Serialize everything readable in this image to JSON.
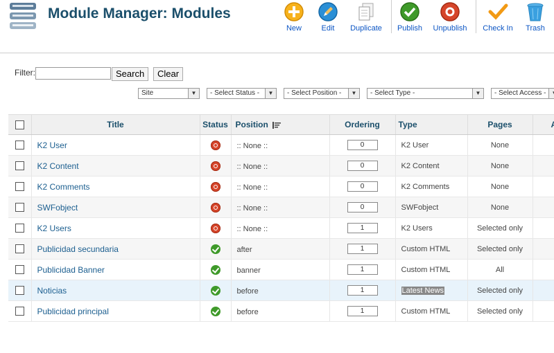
{
  "header": {
    "title": "Module Manager: Modules",
    "toolbar": [
      {
        "label": "New",
        "icon": "new-icon"
      },
      {
        "label": "Edit",
        "icon": "edit-icon"
      },
      {
        "label": "Duplicate",
        "icon": "duplicate-icon"
      },
      {
        "label": "Publish",
        "icon": "publish-icon"
      },
      {
        "label": "Unpublish",
        "icon": "unpublish-icon"
      },
      {
        "label": "Check In",
        "icon": "check-in-icon"
      },
      {
        "label": "Trash",
        "icon": "trash-icon"
      }
    ]
  },
  "filter": {
    "label": "Filter:",
    "value": "",
    "search_label": "Search",
    "clear_label": "Clear"
  },
  "selects": {
    "client": "Site",
    "status": "- Select Status -",
    "position": "- Select Position -",
    "type": "- Select Type -",
    "access": "- Select Access -"
  },
  "table": {
    "headers": {
      "title": "Title",
      "status": "Status",
      "position": "Position",
      "ordering": "Ordering",
      "type": "Type",
      "pages": "Pages",
      "access": "A"
    },
    "rows": [
      {
        "title": "K2 User",
        "status": "unpublished",
        "position": ":: None ::",
        "ordering": "0",
        "type": "K2 User",
        "pages": "None"
      },
      {
        "title": "K2 Content",
        "status": "unpublished",
        "position": ":: None ::",
        "ordering": "0",
        "type": "K2 Content",
        "pages": "None"
      },
      {
        "title": "K2 Comments",
        "status": "unpublished",
        "position": ":: None ::",
        "ordering": "0",
        "type": "K2 Comments",
        "pages": "None"
      },
      {
        "title": "SWFobject",
        "status": "unpublished",
        "position": ":: None ::",
        "ordering": "0",
        "type": "SWFobject",
        "pages": "None"
      },
      {
        "title": "K2 Users",
        "status": "unpublished",
        "position": ":: None ::",
        "ordering": "1",
        "type": "K2 Users",
        "pages": "Selected only"
      },
      {
        "title": "Publicidad secundaria",
        "status": "published",
        "position": "after",
        "ordering": "1",
        "type": "Custom HTML",
        "pages": "Selected only"
      },
      {
        "title": "Publicidad Banner",
        "status": "published",
        "position": "banner",
        "ordering": "1",
        "type": "Custom HTML",
        "pages": "All"
      },
      {
        "title": "Noticias",
        "status": "published",
        "position": "before",
        "ordering": "1",
        "type": "Latest News",
        "pages": "Selected only"
      },
      {
        "title": "Publicidad principal",
        "status": "published",
        "position": "before",
        "ordering": "1",
        "type": "Custom HTML",
        "pages": "Selected only"
      }
    ]
  },
  "colors": {
    "title": "#1b4f6b",
    "link": "#1b5e8f",
    "toolbar_label": "#0b55c4",
    "published": "#3f9a2a",
    "unpublished": "#d6452a"
  }
}
